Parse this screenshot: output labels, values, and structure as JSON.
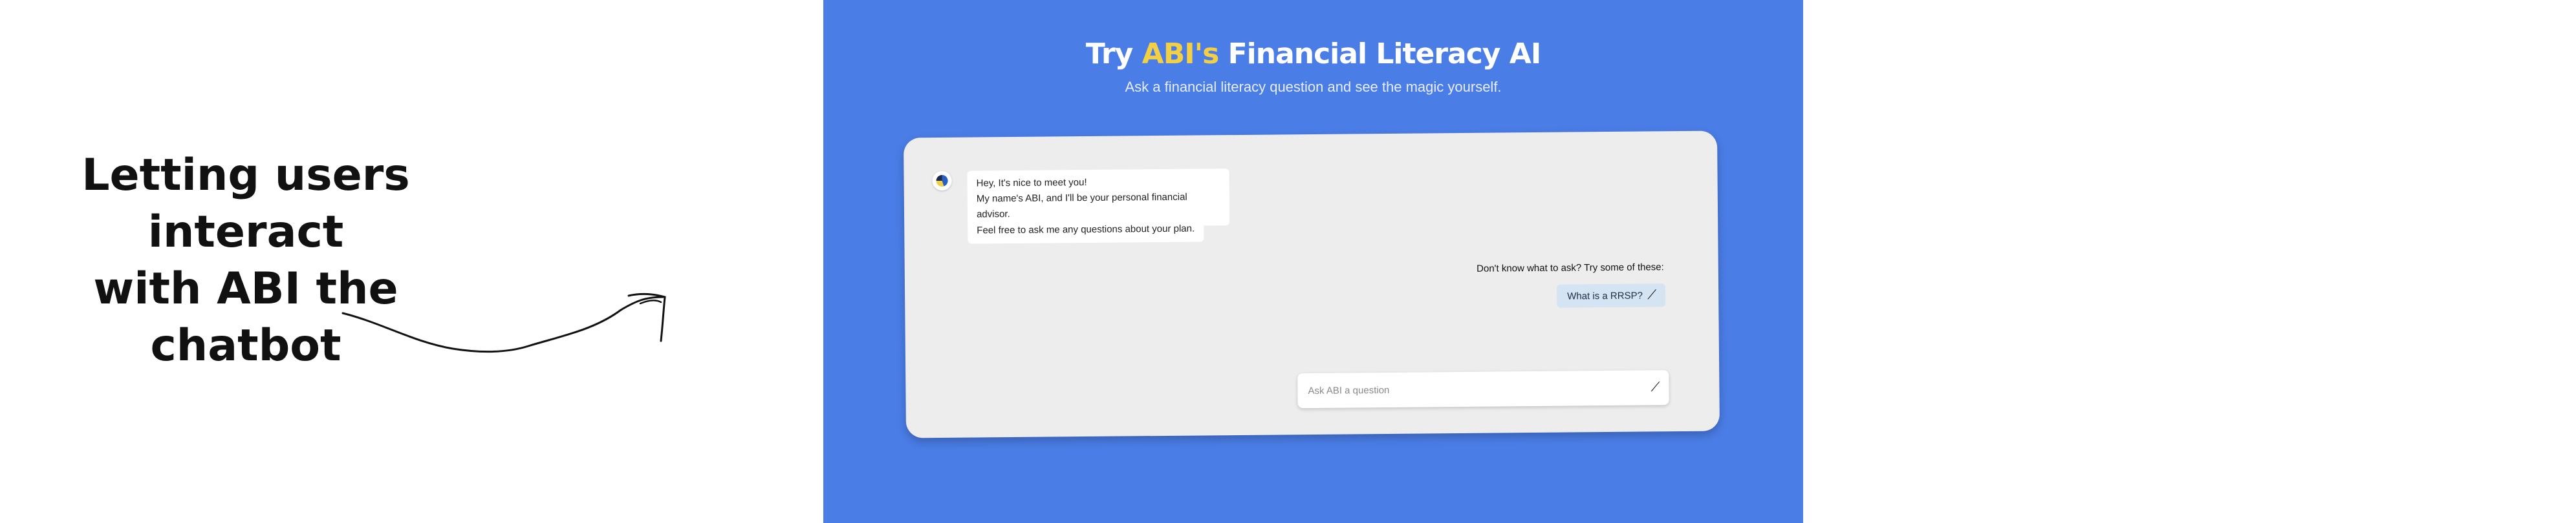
{
  "caption": {
    "line1": "Letting users interact",
    "line2": "with ABI the chatbot"
  },
  "hero": {
    "title_prefix": "Try",
    "title_highlight": "ABI's",
    "title_suffix": "Financial Literacy AI",
    "subtitle": "Ask a financial literacy question and see the magic yourself."
  },
  "chat": {
    "greeting": [
      "Hey, It's nice to meet you!",
      "My name's ABI, and I'll be your personal financial advisor."
    ],
    "followup": "Feel free to ask me any questions about your plan.",
    "suggestions_title": "Don't know what to ask? Try some of these:",
    "suggestions": [
      "What is a RRSP?"
    ],
    "input_placeholder": "Ask ABI a question"
  },
  "colors": {
    "panel": "#4a7de6",
    "highlight": "#f2cf45",
    "card": "#ededed",
    "chip": "#d4e4f3"
  },
  "icons": {
    "send": "send-arrow-icon",
    "avatar": "abi-logo-icon",
    "annotation": "hand-drawn-arrow-icon"
  }
}
